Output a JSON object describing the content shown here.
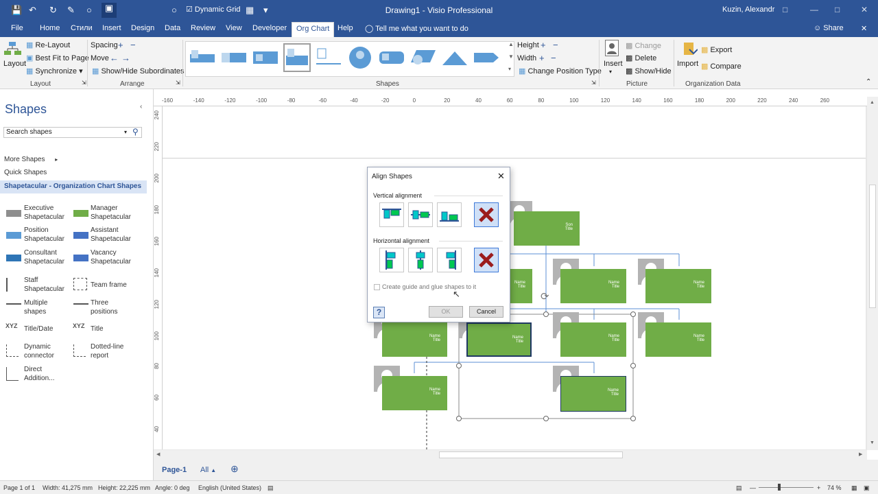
{
  "titlebar": {
    "qat_dynamic_grid": "Dynamic Grid",
    "title": "Drawing1 - Visio Professional",
    "user": "Kuzin, Alexandr"
  },
  "tabs": [
    "File",
    "Home",
    "Стили",
    "Insert",
    "Design",
    "Data",
    "Review",
    "View",
    "Developer",
    "Org Chart",
    "Help"
  ],
  "tell_me": "Tell me what you want to do",
  "share": "Share",
  "ribbon": {
    "layout": {
      "layout_btn": "Layout",
      "relayout": "Re-Layout",
      "bestfit": "Best Fit to Page",
      "sync": "Synchronize",
      "group": "Layout"
    },
    "arrange": {
      "spacing": "Spacing",
      "move": "Move",
      "showhide": "Show/Hide Subordinates",
      "group": "Arrange"
    },
    "shapes": {
      "group": "Shapes",
      "height": "Height",
      "width": "Width",
      "change_position": "Change Position Type"
    },
    "picture": {
      "insert": "Insert",
      "change": "Change",
      "delete": "Delete",
      "showhide": "Show/Hide",
      "group": "Picture"
    },
    "orgdata": {
      "import": "Import",
      "export": "Export",
      "compare": "Compare",
      "group": "Organization Data"
    }
  },
  "pane": {
    "title": "Shapes",
    "search_placeholder": "Search shapes",
    "more_shapes": "More Shapes",
    "quick_shapes": "Quick Shapes",
    "stencil": "Shapetacular - Organization Chart Shapes",
    "items": [
      {
        "l1": "Executive",
        "l2": "Shapetacular"
      },
      {
        "l1": "Manager",
        "l2": "Shapetacular"
      },
      {
        "l1": "Position",
        "l2": "Shapetacular"
      },
      {
        "l1": "Assistant",
        "l2": "Shapetacular"
      },
      {
        "l1": "Consultant",
        "l2": "Shapetacular"
      },
      {
        "l1": "Vacancy",
        "l2": "Shapetacular"
      },
      {
        "l1": "Staff",
        "l2": "Shapetacular"
      },
      {
        "l1": "Team frame",
        "l2": ""
      },
      {
        "l1": "Multiple",
        "l2": "shapes"
      },
      {
        "l1": "Three",
        "l2": "positions"
      },
      {
        "l1": "Title/Date",
        "l2": ""
      },
      {
        "l1": "Title",
        "l2": ""
      },
      {
        "l1": "Dynamic",
        "l2": "connector"
      },
      {
        "l1": "Dotted-line",
        "l2": "report"
      },
      {
        "l1": "Direct",
        "l2": "Addition..."
      }
    ]
  },
  "ruler_top": [
    "-160",
    "-140",
    "-120",
    "-100",
    "-80",
    "-60",
    "-40",
    "-20",
    "0",
    "20",
    "40",
    "60",
    "80",
    "100",
    "120",
    "140",
    "160",
    "180",
    "200",
    "220",
    "240",
    "260"
  ],
  "ruler_left": [
    "240",
    "220",
    "200",
    "180",
    "160",
    "140",
    "120",
    "100",
    "80",
    "60",
    "40"
  ],
  "org": {
    "box_name": "Name",
    "box_title": "Title",
    "top_name": "Son",
    "top_title": "Title"
  },
  "dialog": {
    "title": "Align Shapes",
    "vertical": "Vertical alignment",
    "horizontal": "Horizontal alignment",
    "glue": "Create guide and glue shapes to it",
    "ok": "OK",
    "cancel": "Cancel"
  },
  "pagetabs": {
    "page": "Page-1",
    "all": "All"
  },
  "status": {
    "page": "Page 1 of 1",
    "width": "Width: 41,275 mm",
    "height": "Height: 22,225 mm",
    "angle": "Angle: 0 deg",
    "language": "English (United States)",
    "zoom": "74 %"
  },
  "colors": {
    "brand": "#2e5597",
    "node": "#70ad47"
  }
}
